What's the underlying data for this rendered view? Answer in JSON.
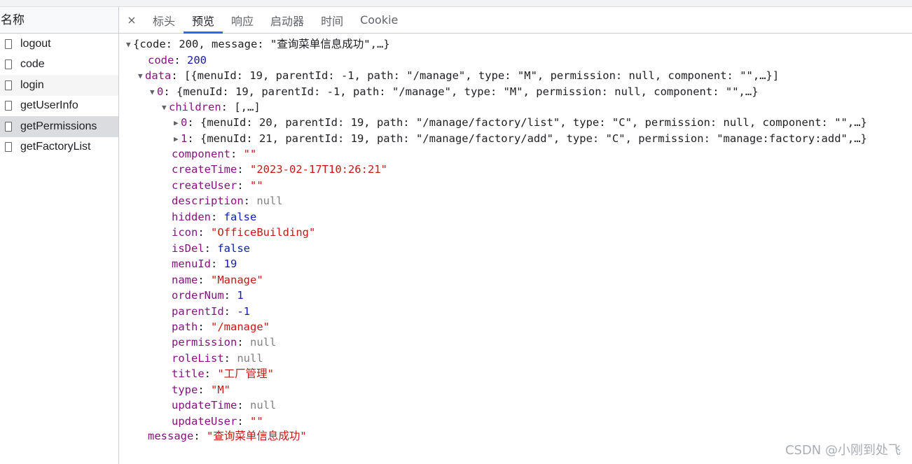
{
  "left_panel": {
    "header": "名称",
    "requests": [
      "logout",
      "code",
      "login",
      "getUserInfo",
      "getPermissions",
      "getFactoryList"
    ],
    "selected_index": 4
  },
  "tabs": {
    "close": "×",
    "items": [
      "标头",
      "预览",
      "响应",
      "启动器",
      "时间",
      "Cookie"
    ],
    "active_index": 1
  },
  "preview": {
    "root_summary": "{code: 200, message: \"查询菜单信息成功\",…}",
    "code_key": "code",
    "code_val": "200",
    "data_key": "data",
    "data_summary": "[{menuId: 19, parentId: -1, path: \"/manage\", type: \"M\", permission: null, component: \"\",…}]",
    "item0_key": "0",
    "item0_summary": "{menuId: 19, parentId: -1, path: \"/manage\", type: \"M\", permission: null, component: \"\",…}",
    "children_key": "children",
    "children_summary": "[,…]",
    "child0_key": "0",
    "child0_summary": "{menuId: 20, parentId: 19, path: \"/manage/factory/list\", type: \"C\", permission: null, component: \"\",…}",
    "child1_key": "1",
    "child1_summary": "{menuId: 21, parentId: 19, path: \"/manage/factory/add\", type: \"C\", permission: \"manage:factory:add\",…}",
    "fields": [
      {
        "key": "component",
        "value": "\"\"",
        "kind": "s"
      },
      {
        "key": "createTime",
        "value": "\"2023-02-17T10:26:21\"",
        "kind": "s"
      },
      {
        "key": "createUser",
        "value": "\"\"",
        "kind": "s"
      },
      {
        "key": "description",
        "value": "null",
        "kind": "nl"
      },
      {
        "key": "hidden",
        "value": "false",
        "kind": "b"
      },
      {
        "key": "icon",
        "value": "\"OfficeBuilding\"",
        "kind": "s"
      },
      {
        "key": "isDel",
        "value": "false",
        "kind": "b"
      },
      {
        "key": "menuId",
        "value": "19",
        "kind": "n"
      },
      {
        "key": "name",
        "value": "\"Manage\"",
        "kind": "s"
      },
      {
        "key": "orderNum",
        "value": "1",
        "kind": "n"
      },
      {
        "key": "parentId",
        "value": "-1",
        "kind": "n"
      },
      {
        "key": "path",
        "value": "\"/manage\"",
        "kind": "s"
      },
      {
        "key": "permission",
        "value": "null",
        "kind": "nl"
      },
      {
        "key": "roleList",
        "value": "null",
        "kind": "nl"
      },
      {
        "key": "title",
        "value": "\"工厂管理\"",
        "kind": "s"
      },
      {
        "key": "type",
        "value": "\"M\"",
        "kind": "s"
      },
      {
        "key": "updateTime",
        "value": "null",
        "kind": "nl"
      },
      {
        "key": "updateUser",
        "value": "\"\"",
        "kind": "s"
      }
    ],
    "message_key": "message",
    "message_val": "\"查询菜单信息成功\""
  },
  "watermark": "CSDN @小刚到处飞",
  "colors": {
    "key": "#881280",
    "string": "#c41a16",
    "number": "#1a1aa6",
    "null": "#808080",
    "accent": "#1a73e8"
  }
}
